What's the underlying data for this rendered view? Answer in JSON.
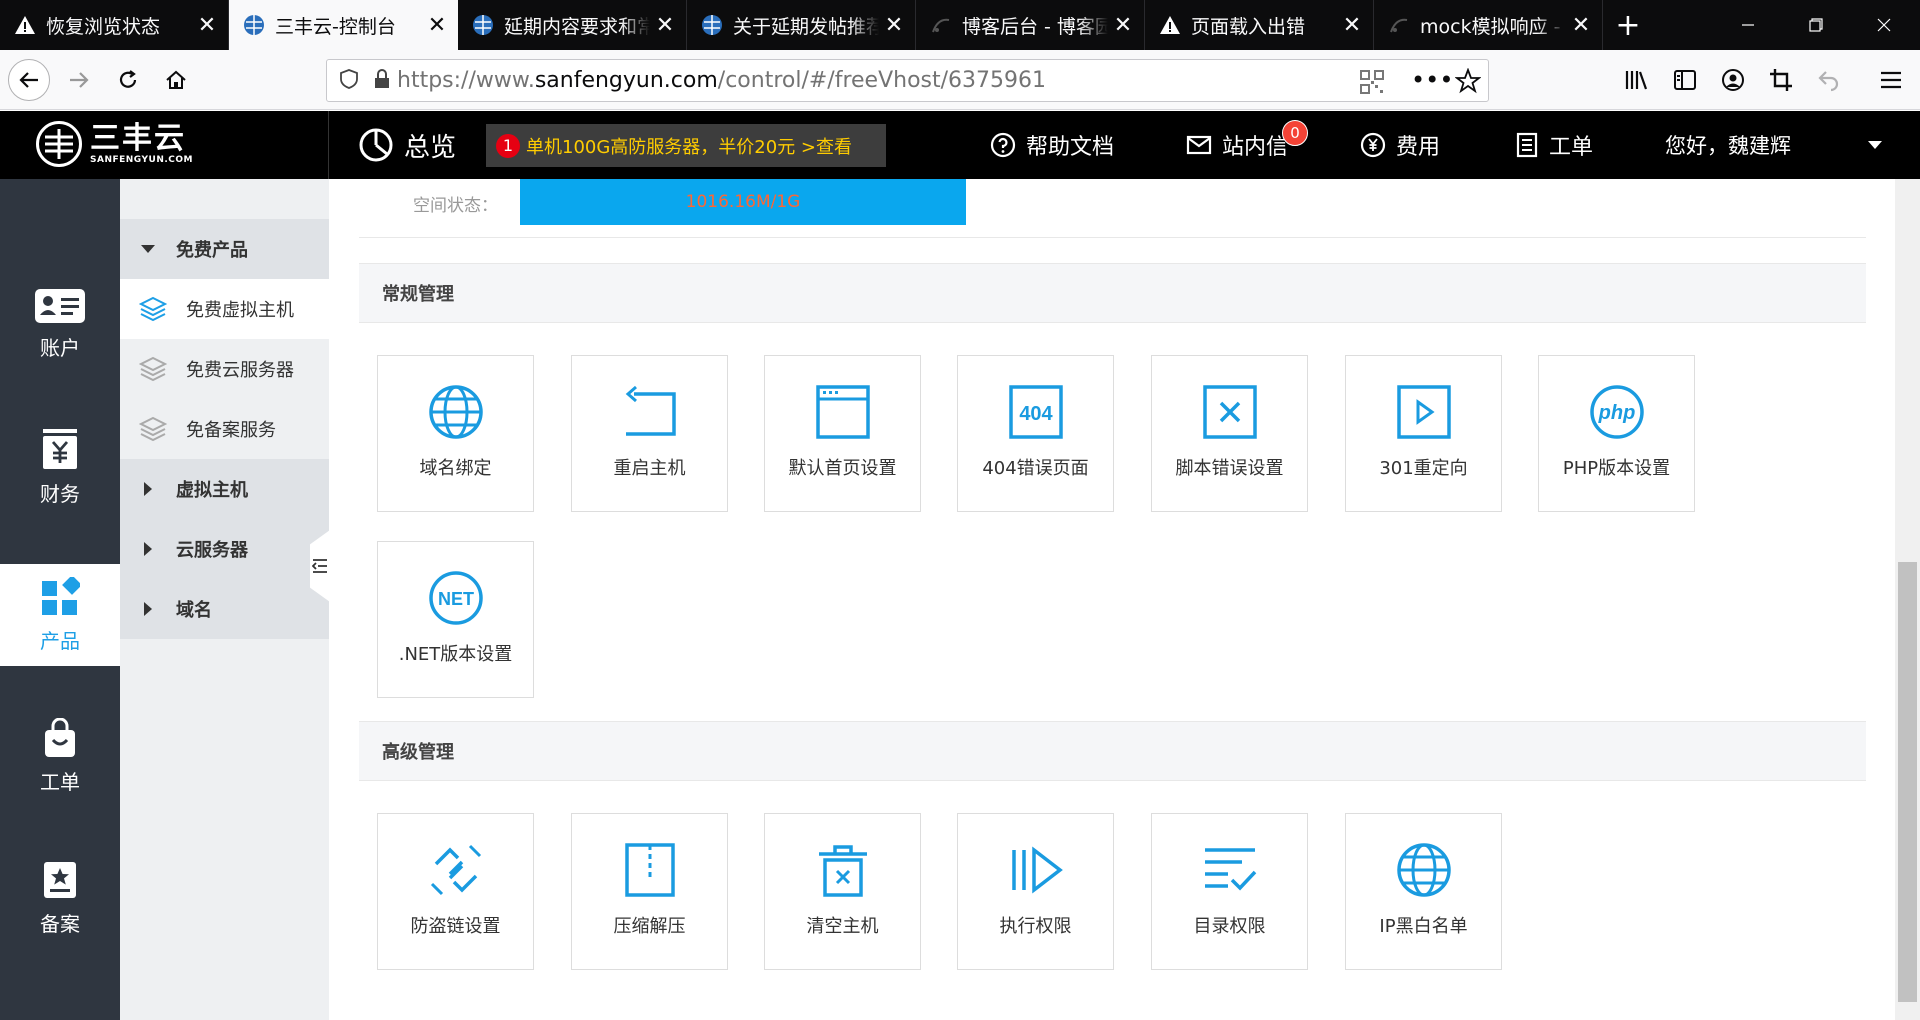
{
  "browser": {
    "tabs": [
      {
        "title": "恢复浏览状态",
        "icon": "warning-icon"
      },
      {
        "title": "三丰云-控制台",
        "icon": "site-globe-icon",
        "active": true
      },
      {
        "title": "延期内容要求和常",
        "icon": "site-globe-icon"
      },
      {
        "title": "关于延期发帖推荐",
        "icon": "site-globe-icon"
      },
      {
        "title": "博客后台 - 博客园",
        "icon": "cnblogs-icon"
      },
      {
        "title": "页面载入出错",
        "icon": "warning-icon"
      },
      {
        "title": "mock模拟响应 - ",
        "icon": "cnblogs-icon"
      }
    ],
    "close_glyph": "✕",
    "new_tab_glyph": "+",
    "url_prefix": "https://www.",
    "url_domain": "sanfengyun.com",
    "url_path": "/control/#/freeVhost/6375961"
  },
  "header": {
    "logo_cn": "三丰云",
    "logo_en": "SANFENGYUN.COM",
    "overview": "总览",
    "promo_num": "1",
    "promo_text": "单机100G高防服务器，半价20元  >查看",
    "help": "帮助文档",
    "messages": "站内信",
    "messages_badge": "0",
    "fees": "费用",
    "tickets": "工单",
    "greeting": "您好，魏建辉"
  },
  "rail": {
    "items": [
      {
        "label": "账户",
        "icon": "account-card-icon"
      },
      {
        "label": "财务",
        "icon": "finance-yen-icon"
      },
      {
        "label": "产品",
        "icon": "product-grid-icon",
        "active": true
      },
      {
        "label": "工单",
        "icon": "ticket-bag-icon"
      },
      {
        "label": "备案",
        "icon": "record-star-icon"
      }
    ]
  },
  "submenu": {
    "group_free": "免费产品",
    "free_vhost": "免费虚拟主机",
    "free_cloud": "免费云服务器",
    "free_record": "免备案服务",
    "group_vhost": "虚拟主机",
    "group_cloud": "云服务器",
    "group_domain": "域名"
  },
  "main": {
    "space_label": "空间状态：",
    "space_value": "1016.16M/1G",
    "space_usage": 0.99,
    "section_regular": "常规管理",
    "section_advanced": "高级管理",
    "regular_tiles": [
      {
        "label": "域名绑定",
        "icon": "globe-icon"
      },
      {
        "label": "重启主机",
        "icon": "restart-icon"
      },
      {
        "label": "默认首页设置",
        "icon": "browser-window-icon"
      },
      {
        "label": "404错误页面",
        "icon": "error-404-icon"
      },
      {
        "label": "脚本错误设置",
        "icon": "script-error-icon"
      },
      {
        "label": "301重定向",
        "icon": "redirect-icon"
      },
      {
        "label": "PHP版本设置",
        "icon": "php-icon"
      },
      {
        "label": ".NET版本设置",
        "icon": "dotnet-icon"
      }
    ],
    "advanced_tiles": [
      {
        "label": "防盗链设置",
        "icon": "anti-leech-icon"
      },
      {
        "label": "压缩解压",
        "icon": "archive-icon"
      },
      {
        "label": "清空主机",
        "icon": "trash-icon"
      },
      {
        "label": "执行权限",
        "icon": "execute-icon"
      },
      {
        "label": "目录权限",
        "icon": "directory-permission-icon"
      },
      {
        "label": "IP黑白名单",
        "icon": "globe-icon"
      }
    ],
    "icon_404_text": "404",
    "icon_php_text": "php",
    "icon_net_text": "NET"
  },
  "colors": {
    "accent": "#1e9fe6",
    "tile_icon": "#1a9be0",
    "header_bg": "#000000",
    "rail_bg": "#2f3640"
  }
}
